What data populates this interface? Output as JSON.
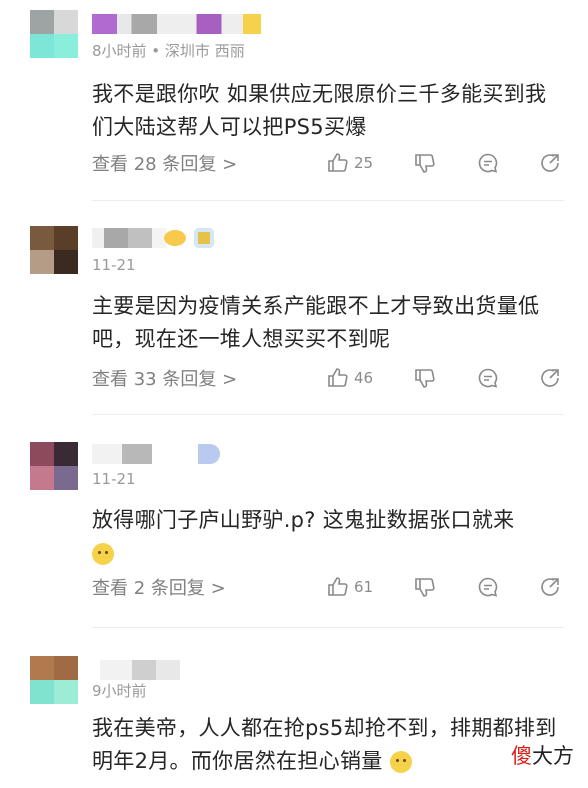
{
  "comments": [
    {
      "meta": "8小时前 • 深圳市 西丽",
      "text": "我不是跟你吹 如果供应无限原价三千多能买到我们大陆这帮人可以把PS5买爆",
      "replies": "查看 28 条回复 >",
      "likes": "25",
      "avatar_colors": [
        "#9ea3a3",
        "#d8d8d8",
        "#7de6d6",
        "#8aeedd"
      ]
    },
    {
      "meta": "11-21",
      "text": "主要是因为疫情关系产能跟不上才导致出货量低吧，现在还一堆人想买买不到呢",
      "replies": "查看 33 条回复 >",
      "likes": "46",
      "avatar_colors": [
        "#7a5a3e",
        "#5a3e2a",
        "#b49c86",
        "#3a2a20"
      ]
    },
    {
      "meta": "11-21",
      "text": "放得哪门子庐山野驴.p? 这鬼扯数据张口就来",
      "replies": "查看 2 条回复 >",
      "likes": "61",
      "avatar_colors": [
        "#8c4a5c",
        "#3a2a36",
        "#c47a8c",
        "#7a6a90"
      ]
    },
    {
      "meta": "9小时前",
      "text": "我在美帝，人人都在抢ps5却抢不到，排期都排到明年2月。而你居然在担心销量",
      "avatar_colors": [
        "#b07a4e",
        "#a06a44",
        "#7fe3cf",
        "#9cecd8"
      ]
    }
  ],
  "watermark": {
    "first": "傻",
    "rest": "大方"
  },
  "colors": {
    "watermark_red": "#d6201a",
    "text": "#262626",
    "muted": "#9a9a9a"
  }
}
